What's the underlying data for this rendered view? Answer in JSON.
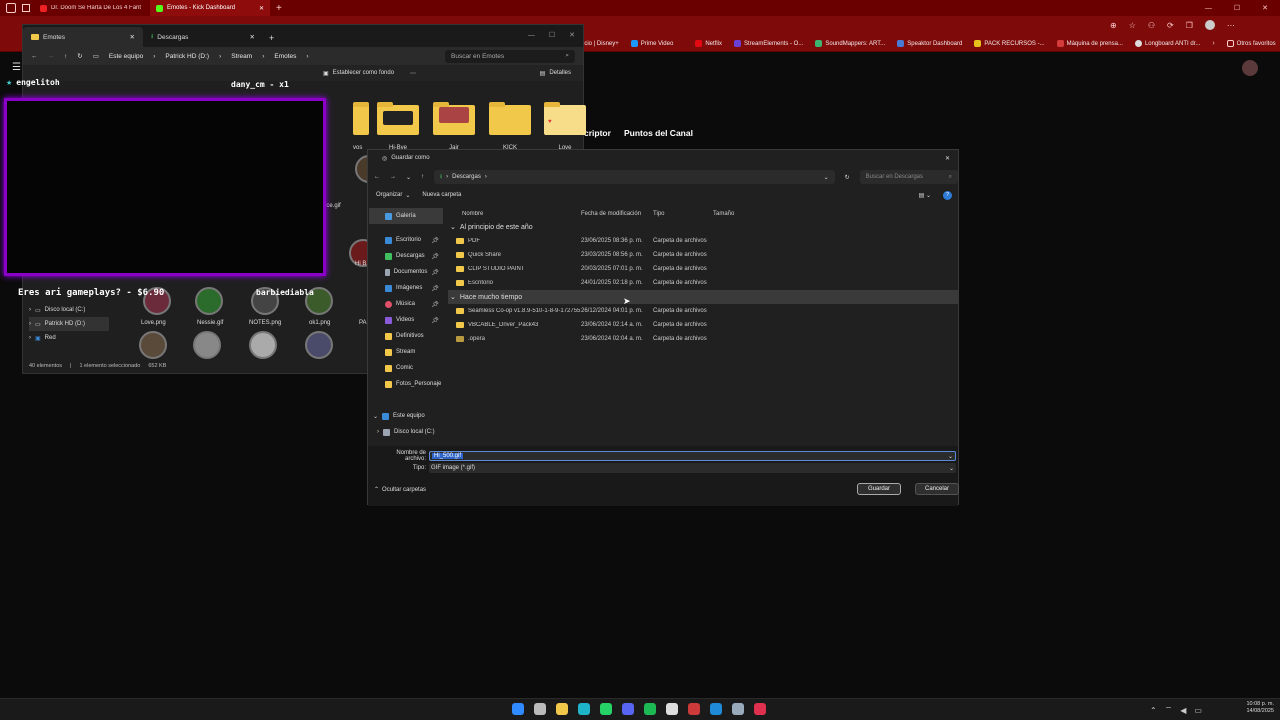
{
  "browser": {
    "tabs": [
      {
        "label": "Dr. Doom Se Harta De Los 4 Fant",
        "color": "#e22"
      },
      {
        "label": "Emotes - Kick Dashboard",
        "color": "#53fc18"
      }
    ],
    "bookmarks": [
      {
        "label": "Inicio | Disney+",
        "color": "#1a3c8f"
      },
      {
        "label": "Prime Video",
        "color": "#1a98ff"
      },
      {
        "label": "Netflix",
        "color": "#e50914"
      },
      {
        "label": "StreamElements - O...",
        "color": "#6a3fd4"
      },
      {
        "label": "SoundMappers: ART...",
        "color": "#3cb371"
      },
      {
        "label": "Speaktor Dashboard",
        "color": "#4a7bd4"
      },
      {
        "label": "PACK RECURSOS -...",
        "color": "#e8c21c"
      },
      {
        "label": "Máquina de prensa...",
        "color": "#d43c3c"
      },
      {
        "label": "Longboard ANTI dr...",
        "color": "#dddddd"
      }
    ],
    "other_favorites": "Otros favoritos",
    "page_headings": [
      "criptor",
      "Puntos del Canal"
    ]
  },
  "explorer": {
    "tabs": [
      "Emotes",
      "Descargas"
    ],
    "breadcrumb": [
      "Este equipo",
      "Patrick HD (D:)",
      "Stream",
      "Emotes"
    ],
    "search_placeholder": "Buscar en Emotes",
    "toolbar": {
      "set_bg": "Establecer como fondo",
      "details": "Detalles"
    },
    "folders_top": [
      "Hi-Bye",
      "Jair",
      "KICK",
      "Love"
    ],
    "emote_labels": [
      "Love.png",
      "Nessie.gif",
      "NOTES.png",
      "ok1.png"
    ],
    "side": [
      {
        "label": "Disco local (C:)"
      },
      {
        "label": "Patrick HD (D:)"
      },
      {
        "label": "Red"
      }
    ],
    "status": {
      "count": "40 elementos",
      "selected": "1 elemento seleccionado",
      "size": "652 KB"
    },
    "partial_labels": [
      "vos",
      "nce.gif",
      "Hi B",
      "PA"
    ]
  },
  "overlay": {
    "user_top_left": "engelitoh",
    "user_top_right": "dany_cm - x1",
    "donation_text": "Eres ari gameplays? - $6.90",
    "user_bottom_right": "barbiediabla"
  },
  "dialog": {
    "title": "Guardar como",
    "path": "Descargas",
    "search_placeholder": "Buscar en Descargas",
    "organize": "Organizar",
    "new_folder": "Nueva carpeta",
    "side": [
      {
        "label": "Galería",
        "color": "#4a9ae0",
        "pinned": false,
        "selected": true
      },
      {
        "label": "Escritorio",
        "color": "#3b8ad8",
        "pinned": true
      },
      {
        "label": "Descargas",
        "color": "#3fbf5f",
        "pinned": true
      },
      {
        "label": "Documentos",
        "color": "#9aa5b1",
        "pinned": true
      },
      {
        "label": "Imágenes",
        "color": "#3b8ad8",
        "pinned": true
      },
      {
        "label": "Música",
        "color": "#e0506a",
        "pinned": true
      },
      {
        "label": "Videos",
        "color": "#8a5ad8",
        "pinned": true
      },
      {
        "label": "Definitivos",
        "color": "#f2c84b",
        "pinned": false
      },
      {
        "label": "Stream",
        "color": "#f2c84b",
        "pinned": false
      },
      {
        "label": "Comic",
        "color": "#f2c84b",
        "pinned": false
      },
      {
        "label": "Fotos_Personaje",
        "color": "#f2c84b",
        "pinned": false
      }
    ],
    "side_tree": [
      {
        "label": "Este equipo",
        "color": "#3b8ad8"
      },
      {
        "label": "Disco local (C:)",
        "color": "#9aa5b1"
      }
    ],
    "columns": [
      "Nombre",
      "Fecha de modificación",
      "Tipo",
      "Tamaño"
    ],
    "groups": [
      {
        "name": "Al principio de este año",
        "rows": [
          {
            "name": "PDF",
            "date": "23/06/2025 08:36 p. m.",
            "type": "Carpeta de archivos"
          },
          {
            "name": "Quick Share",
            "date": "23/03/2025 08:56 p. m.",
            "type": "Carpeta de archivos"
          },
          {
            "name": "CLIP STUDIO PAINT",
            "date": "20/03/2025 07:01 p. m.",
            "type": "Carpeta de archivos"
          },
          {
            "name": "Escritorio",
            "date": "24/01/2025 02:18 p. m.",
            "type": "Carpeta de archivos"
          }
        ]
      },
      {
        "name": "Hace mucho tiempo",
        "rows": [
          {
            "name": "Seamless Co-op v1.8.9-510-1-8-9-172755...",
            "date": "26/12/2024 04:01 p. m.",
            "type": "Carpeta de archivos"
          },
          {
            "name": "VBCABLE_Driver_Pack43",
            "date": "23/06/2024 02:14 a. m.",
            "type": "Carpeta de archivos"
          },
          {
            "name": ".opera",
            "date": "23/06/2024 02:04 a. m.",
            "type": "Carpeta de archivos"
          }
        ]
      }
    ],
    "filename_label": "Nombre de archivo:",
    "filename_value": "Hi_500.gif",
    "type_label": "Tipo:",
    "type_value": "GIF image (*.gif)",
    "hide_folders": "Ocultar carpetas",
    "save": "Guardar",
    "cancel": "Cancelar"
  },
  "taskbar": {
    "icons": [
      {
        "name": "windows-start-icon",
        "color": "#2f8bff"
      },
      {
        "name": "task-view-icon",
        "color": "#bbbbbb"
      },
      {
        "name": "file-explorer-icon",
        "color": "#f2c84b"
      },
      {
        "name": "edge-icon",
        "color": "#1fb5c8"
      },
      {
        "name": "whatsapp-icon",
        "color": "#25d366"
      },
      {
        "name": "discord-icon",
        "color": "#5865f2"
      },
      {
        "name": "spotify-icon",
        "color": "#1db954"
      },
      {
        "name": "chatgpt-icon",
        "color": "#dddddd"
      },
      {
        "name": "calendar-app-icon",
        "color": "#cc3a3a"
      },
      {
        "name": "ccleaner-icon",
        "color": "#1f8bd8"
      },
      {
        "name": "steam-icon",
        "color": "#9ab"
      },
      {
        "name": "opera-gx-icon",
        "color": "#e03050"
      }
    ],
    "time": "10:08 p. m.",
    "date": "14/08/2025"
  }
}
